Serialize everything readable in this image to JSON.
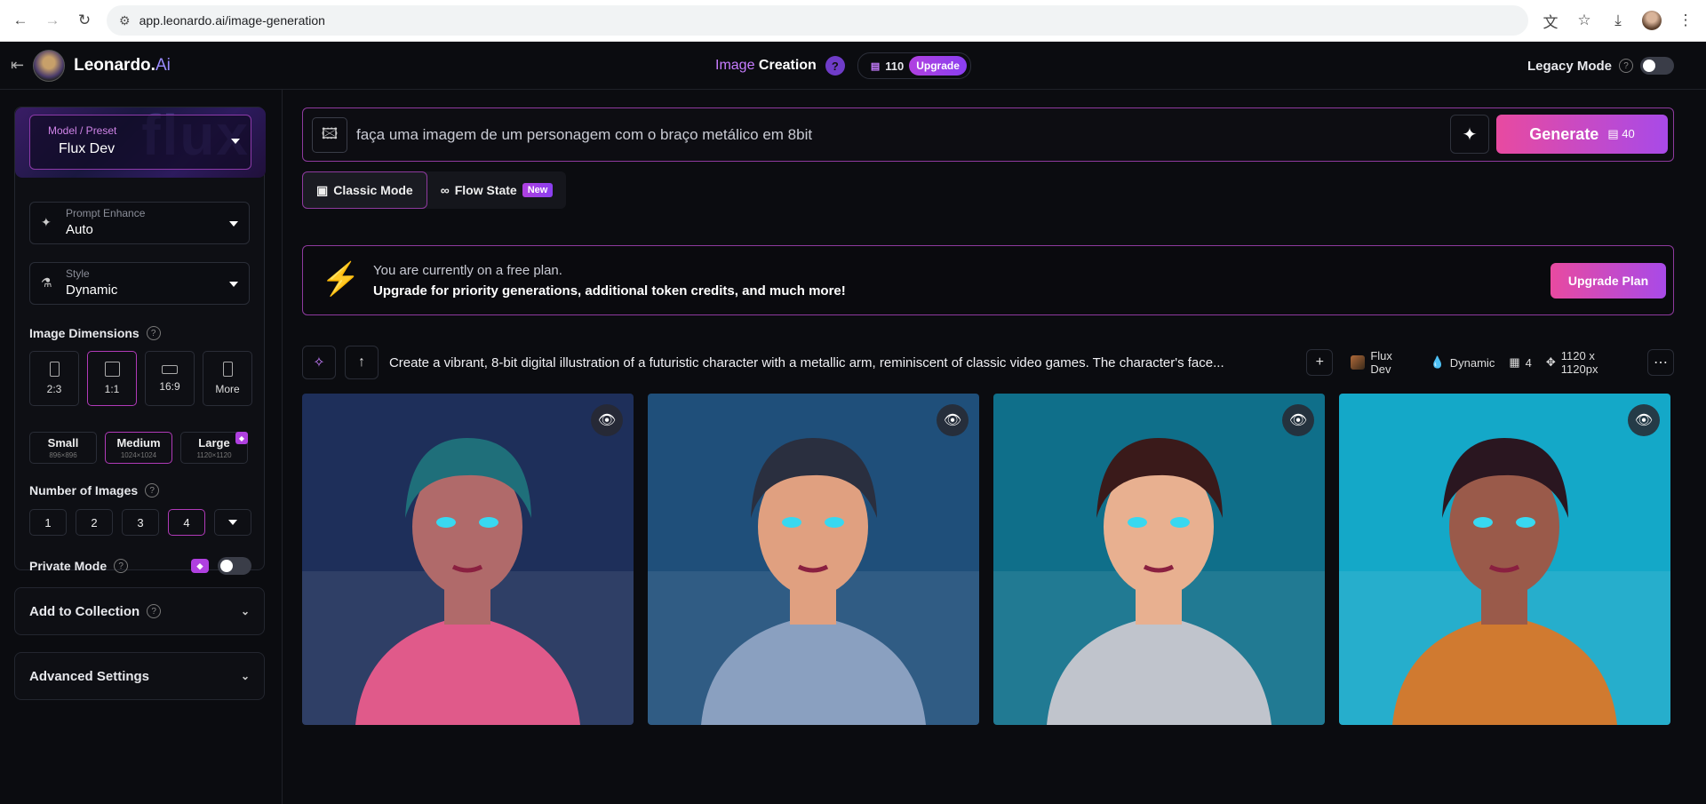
{
  "browser": {
    "url": "app.leonardo.ai/image-generation"
  },
  "header": {
    "brand_main": "Leonardo.",
    "brand_accent": "Ai",
    "title_accent": "Image",
    "title_main": "Creation",
    "help": "?",
    "tokens": "110",
    "upgrade": "Upgrade",
    "legacy_mode": "Legacy Mode",
    "legacy_help": "?"
  },
  "sidebar": {
    "model_label": "Model / Preset",
    "model_value": "Flux Dev",
    "model_bg_text": "flux",
    "prompt_enhance_label": "Prompt Enhance",
    "prompt_enhance_value": "Auto",
    "style_label": "Style",
    "style_value": "Dynamic",
    "image_dimensions": "Image Dimensions",
    "aspect_ratios": [
      {
        "label": "2:3"
      },
      {
        "label": "1:1",
        "active": true
      },
      {
        "label": "16:9"
      },
      {
        "label": "More"
      }
    ],
    "sizes": [
      {
        "name": "Small",
        "dims": "896×896"
      },
      {
        "name": "Medium",
        "dims": "1024×1024",
        "active": true
      },
      {
        "name": "Large",
        "dims": "1120×1120"
      }
    ],
    "number_of_images": "Number of Images",
    "counts": [
      "1",
      "2",
      "3",
      "4"
    ],
    "selected_count": "4",
    "private_mode": "Private Mode",
    "add_to_collection": "Add to Collection",
    "advanced_settings": "Advanced Settings"
  },
  "prompt": {
    "text": "faça uma imagem de um personagem com o braço metálico em 8bit",
    "generate_label": "Generate",
    "generate_cost": "40"
  },
  "modes": {
    "classic": "Classic Mode",
    "flow": "Flow State",
    "new_badge": "New"
  },
  "banner": {
    "line1": "You are currently on a free plan.",
    "line2": "Upgrade for priority generations, additional token credits, and much more!",
    "button": "Upgrade Plan"
  },
  "generation": {
    "prompt_text": "Create a vibrant, 8-bit digital illustration of a futuristic character with a metallic arm, reminiscent of classic video games. The character's face...",
    "model": "Flux Dev",
    "style": "Dynamic",
    "count": "4",
    "size": "1120 x 1120px"
  },
  "images": [
    {
      "bg": "#1e2f5a",
      "accent": "#e05a8a",
      "hair": "#1f6f7a",
      "skin": "#b06a6a"
    },
    {
      "bg": "#1f4f7a",
      "accent": "#8aa0c0",
      "hair": "#2a2f3f",
      "skin": "#e0a080"
    },
    {
      "bg": "#0f6f8a",
      "accent": "#c0c4cc",
      "hair": "#3a1a1a",
      "skin": "#e8b090"
    },
    {
      "bg": "#14a8c8",
      "accent": "#d07a30",
      "hair": "#2a1620",
      "skin": "#9a5a4a"
    }
  ],
  "colors": {
    "accent_pink": "#e84aa0",
    "accent_purple": "#a84ae8",
    "border_active": "#b03ab8"
  },
  "icons": [
    "back-icon",
    "forward-icon",
    "reload-icon",
    "tune-icon",
    "translate-icon",
    "star-icon",
    "download-icon",
    "menu-icon",
    "sidebar-collapse-icon",
    "sparkle-icon",
    "image-icon",
    "eye-icon",
    "plus-icon",
    "upload-icon",
    "more-icon",
    "bolt-icon",
    "gem-icon"
  ]
}
